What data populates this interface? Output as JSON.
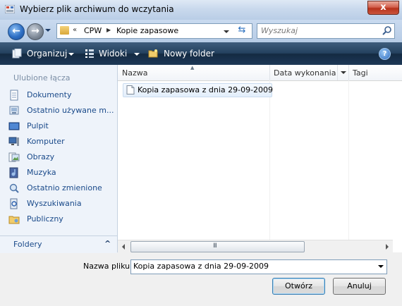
{
  "window": {
    "title": "Wybierz plik archiwum do wczytania",
    "close_label": "x"
  },
  "address": {
    "chevron": "«",
    "segments": [
      "CPW",
      "Kopie zapasowe"
    ],
    "separator": "▶",
    "search_placeholder": "Wyszukaj"
  },
  "toolbar": {
    "organize_label": "Organizuj",
    "views_label": "Widoki",
    "new_folder_label": "Nowy folder",
    "help_label": "?"
  },
  "sidebar": {
    "title": "Ulubione łącza",
    "items": [
      {
        "label": "Dokumenty",
        "icon": "documents-icon"
      },
      {
        "label": "Ostatnio używane m...",
        "icon": "recent-places-icon"
      },
      {
        "label": "Pulpit",
        "icon": "desktop-icon"
      },
      {
        "label": "Komputer",
        "icon": "computer-icon"
      },
      {
        "label": "Obrazy",
        "icon": "pictures-icon"
      },
      {
        "label": "Muzyka",
        "icon": "music-icon"
      },
      {
        "label": "Ostatnio zmienione",
        "icon": "recently-changed-icon"
      },
      {
        "label": "Wyszukiwania",
        "icon": "searches-icon"
      },
      {
        "label": "Publiczny",
        "icon": "public-folder-icon"
      }
    ],
    "folders_label": "Foldery",
    "folders_chevron": "^"
  },
  "filelist": {
    "columns": [
      "Nazwa",
      "Data wykonania",
      "Tagi"
    ],
    "files": [
      {
        "name": "Kopia zapasowa z dnia 29-09-2009"
      }
    ],
    "scroll_grip": "III"
  },
  "footer": {
    "filename_label": "Nazwa pliku:",
    "filename_value": "Kopia zapasowa z dnia 29-09-2009",
    "open_label": "Otwórz",
    "cancel_label": "Anuluj"
  }
}
